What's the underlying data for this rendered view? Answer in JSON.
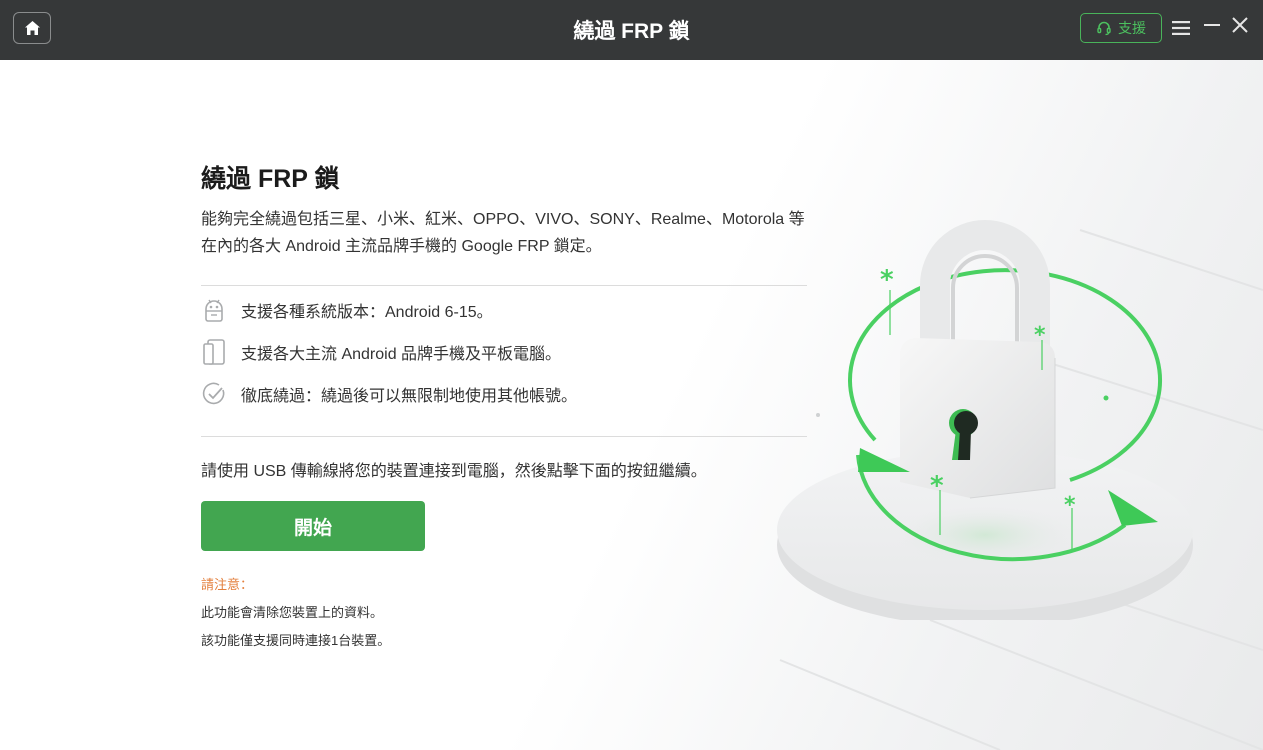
{
  "window": {
    "title": "繞過 FRP 鎖",
    "support_label": "支援"
  },
  "main": {
    "heading": "繞過 FRP 鎖",
    "description": "能夠完全繞過包括三星、小米、紅米、OPPO、VIVO、SONY、Realme、Motorola 等在內的各大 Android 主流品牌手機的 Google FRP 鎖定。",
    "features": [
      {
        "icon": "android-icon",
        "text": "支援各種系統版本：Android 6-15。"
      },
      {
        "icon": "phone-tablet-icon",
        "text": "支援各大主流 Android 品牌手機及平板電腦。"
      },
      {
        "icon": "check-circle-icon",
        "text": "徹底繞過：繞過後可以無限制地使用其他帳號。"
      }
    ],
    "instruction": "請使用 USB 傳輸線將您的裝置連接到電腦，然後點擊下面的按鈕繼續。",
    "start_button": "開始",
    "note": {
      "title": "請注意：",
      "lines": [
        "此功能會清除您裝置上的資料。",
        "該功能僅支援同時連接1台裝置。"
      ]
    }
  },
  "colors": {
    "titlebar": "#363839",
    "accent_green": "#42a650",
    "note_orange": "#e37f3c"
  }
}
